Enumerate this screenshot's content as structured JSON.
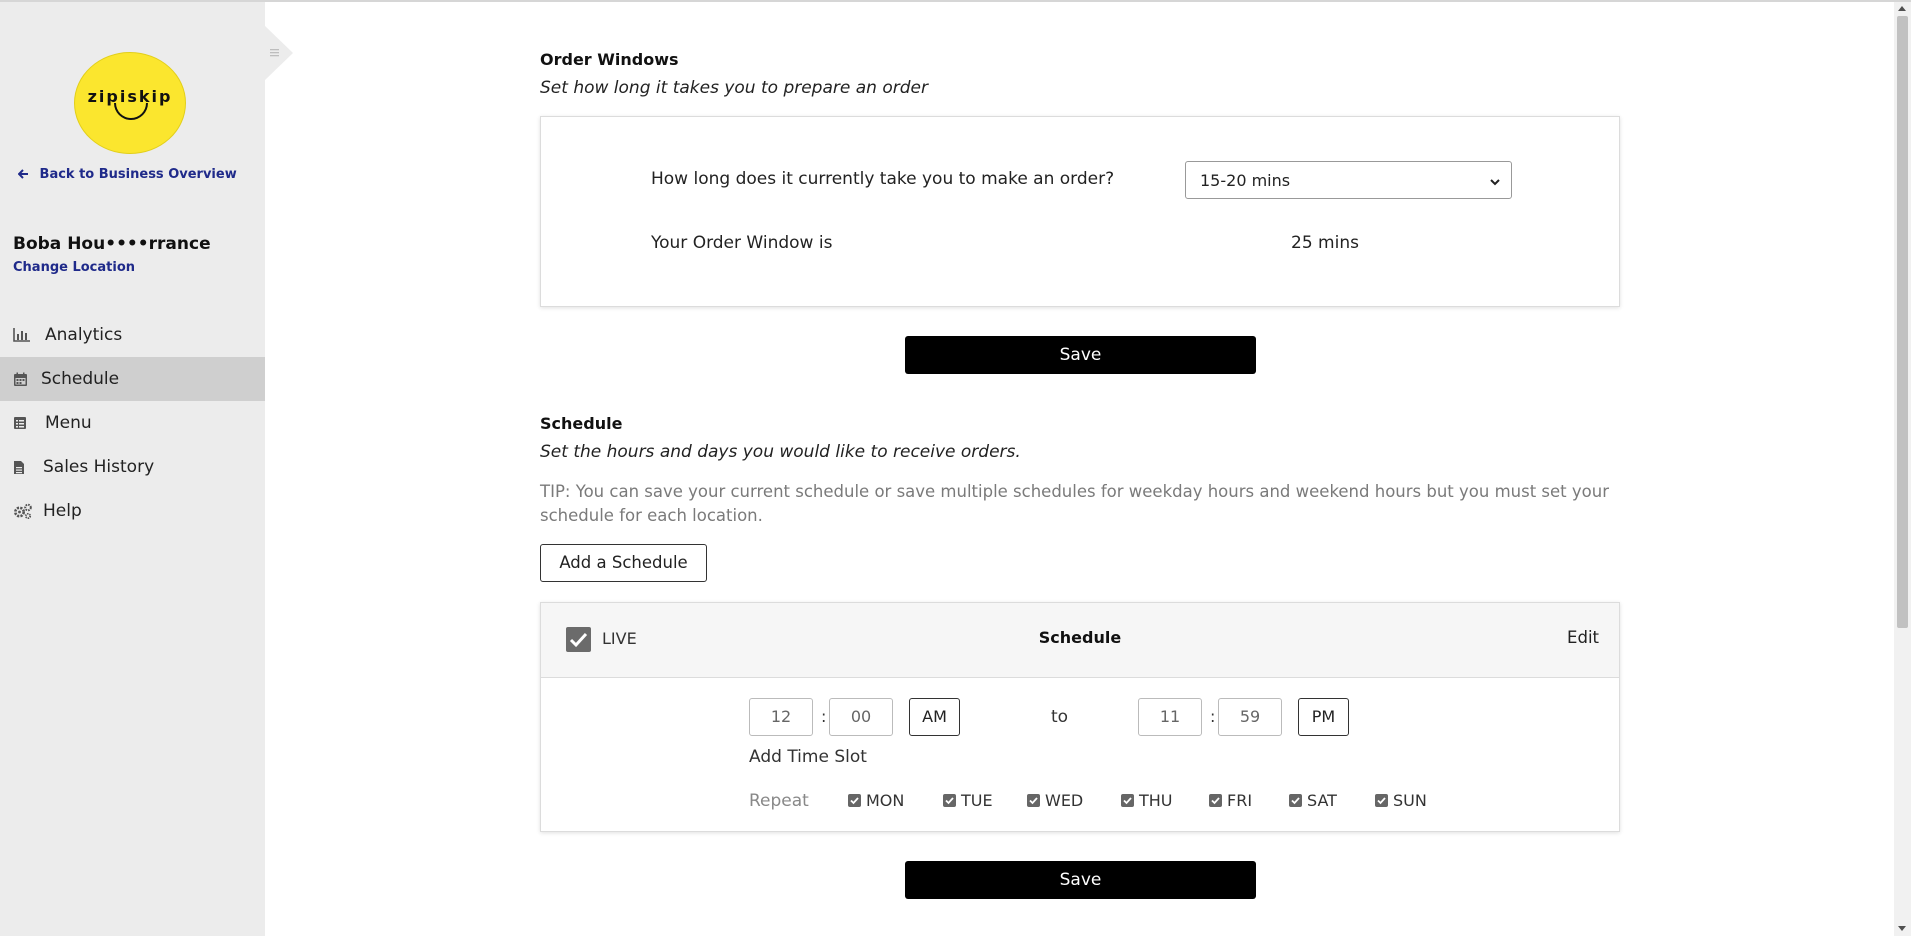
{
  "brand": {
    "logo_text": "zipiskip",
    "accent_color": "#fbe62e"
  },
  "sidebar": {
    "back_link": "Back to Business Overview",
    "location_name": "Boba Hou••••rrance",
    "change_location": "Change Location",
    "items": [
      {
        "label": "Analytics",
        "icon": "bar-chart-icon",
        "active": false
      },
      {
        "label": "Schedule",
        "icon": "calendar-icon",
        "active": true
      },
      {
        "label": "Menu",
        "icon": "list-icon",
        "active": false
      },
      {
        "label": "Sales History",
        "icon": "document-icon",
        "active": false
      },
      {
        "label": "Help",
        "icon": "cogs-icon",
        "active": false
      }
    ]
  },
  "order_windows": {
    "title": "Order Windows",
    "subtitle": "Set how long it takes you to prepare an order",
    "question": "How long does it currently take you to make an order?",
    "selected_time": "15-20 mins",
    "window_label": "Your Order Window is",
    "window_value": "25 mins",
    "save_label": "Save"
  },
  "schedule": {
    "title": "Schedule",
    "subtitle": "Set the hours and days you would like to receive orders.",
    "tip": "TIP: You can save your current schedule or save multiple schedules for weekday hours and weekend hours but you must set your schedule for each location.",
    "add_label": "Add a Schedule",
    "card": {
      "live_label": "LIVE",
      "live_checked": true,
      "name": "Schedule",
      "edit_label": "Edit",
      "start_hour": "12",
      "start_minute": "00",
      "start_period": "AM",
      "to_label": "to",
      "end_hour": "11",
      "end_minute": "59",
      "end_period": "PM",
      "add_slot_label": "Add Time Slot",
      "repeat_label": "Repeat",
      "days": [
        {
          "label": "MON",
          "checked": true
        },
        {
          "label": "TUE",
          "checked": true
        },
        {
          "label": "WED",
          "checked": true
        },
        {
          "label": "THU",
          "checked": true
        },
        {
          "label": "FRI",
          "checked": true
        },
        {
          "label": "SAT",
          "checked": true
        },
        {
          "label": "SUN",
          "checked": true
        }
      ]
    },
    "save_label": "Save"
  }
}
